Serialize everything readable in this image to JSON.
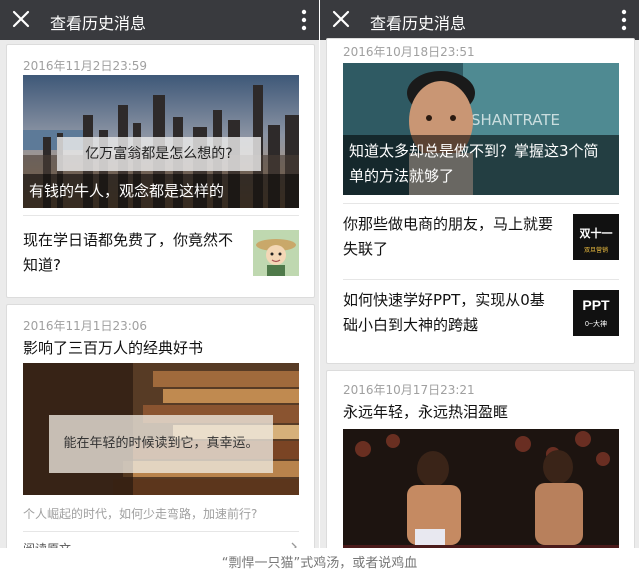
{
  "left": {
    "header_title": "查看历史消息",
    "card1": {
      "date": "2016年11月2日23:59",
      "img_overlay": "亿万富翁都是怎么想的?",
      "caption": "有钱的牛人，观念都是这样的",
      "sub_title": "现在学日语都免费了，你竟然不知道?"
    },
    "card2": {
      "date": "2016年11月1日23:06",
      "headline": "影响了三百万人的经典好书",
      "img_overlay": "能在年轻的时候读到它，真幸运。",
      "summary": "个人崛起的时代，如何少走弯路，加速前行?",
      "read_more": "阅读原文"
    }
  },
  "right": {
    "header_title": "查看历史消息",
    "card1": {
      "date": "2016年10月18日23:51",
      "img_text": "SHANTRATE",
      "caption": "知道太多却总是做不到？掌握这3个简单的方法就够了",
      "sub1_title": "你那些做电商的朋友，马上就要失联了",
      "sub1_thumb_big": "双十一",
      "sub1_thumb_small": "双旦营销",
      "sub2_title": "如何快速学好PPT，实现从0基础小白到大神的跨越",
      "sub2_thumb_big": "PPT",
      "sub2_thumb_small": "0~大神"
    },
    "card2": {
      "date": "2016年10月17日23:21",
      "headline": "永远年轻，永远热泪盈眶"
    }
  },
  "bottom_caption": "“剽悍一只猫”式鸡汤，或者说鸡血"
}
